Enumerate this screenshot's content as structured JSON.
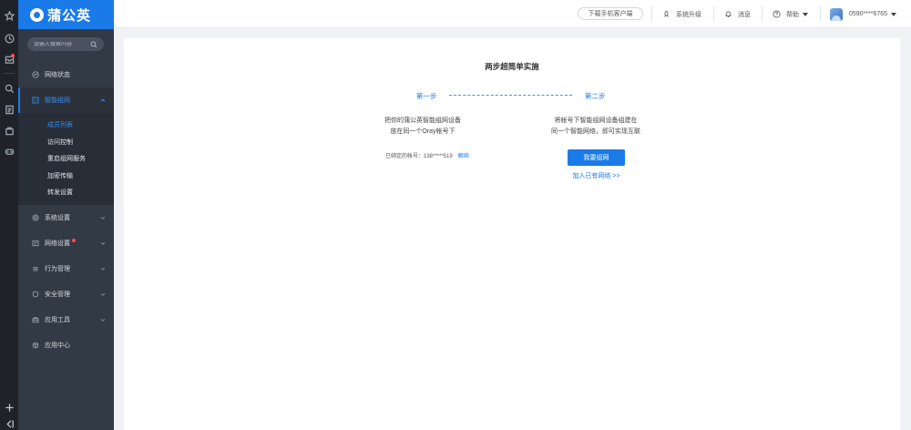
{
  "brand": {
    "name": "蒲公英"
  },
  "search": {
    "placeholder": "请输入搜索内容"
  },
  "nav": {
    "network_status": "网络状态",
    "smart_network": "智能组网",
    "sub_items": [
      "成员列表",
      "访问控制",
      "重启组网服务",
      "加密传输",
      "转发设置"
    ],
    "system_settings": "系统设置",
    "network_settings": "网络设置",
    "behavior_management": "行为管理",
    "security_management": "安全管理",
    "app_tools": "应用工具",
    "app_center": "应用中心"
  },
  "header": {
    "download_client": "下载手机客户端",
    "system_upgrade": "系统升级",
    "messages": "消息",
    "help": "帮助",
    "account": "0590****6765"
  },
  "main": {
    "title": "两步超简单实施",
    "step1": "第一步",
    "step2": "第二步",
    "step1_line1": "把你的蒲公英智能组网设备",
    "step1_line2": "放在同一个Oray帐号下",
    "step2_line1": "将帐号下智能组网设备组建在",
    "step2_line2": "同一个智能网络，即可实现互联",
    "bound_account": "已绑定的帐号：138*****519",
    "unbind": "解绑",
    "primary_button": "我要组网",
    "join_link": "加入已有网络 >>"
  },
  "colors": {
    "accent": "#1a7ae8",
    "sidebar_bg": "#323a45",
    "rail_bg": "#1f2329",
    "badge": "#ff4d4f"
  }
}
